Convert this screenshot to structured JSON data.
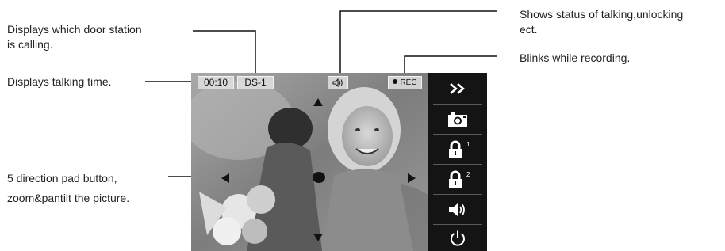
{
  "callouts": {
    "door_station": "Displays which door station\nis calling.",
    "talking_time": "Displays talking time.",
    "direction_pad": "5 direction pad button,\nzoom&pantilt the picture.",
    "status": "Shows status of talking,unlocking\nect.",
    "recording": "Blinks while recording."
  },
  "screen": {
    "talking_time": "00:10",
    "door_station": "DS-1",
    "rec_label": "REC",
    "status_icon": "speaker-talk-icon",
    "dpad_icons": [
      "arrow-up-icon",
      "arrow-down-icon",
      "arrow-left-icon",
      "arrow-right-icon",
      "center-dot-icon"
    ]
  },
  "menu": {
    "buttons": [
      {
        "icon": "double-chevron-right-icon"
      },
      {
        "icon": "camera-icon"
      },
      {
        "icon": "lock-icon",
        "badge": "1"
      },
      {
        "icon": "lock-icon",
        "badge": "2"
      },
      {
        "icon": "speaker-icon"
      },
      {
        "icon": "power-icon"
      }
    ]
  },
  "colors": {
    "menu_bg": "#141414",
    "osd_bg": "#e1e1e1",
    "icon": "#ffffff"
  }
}
